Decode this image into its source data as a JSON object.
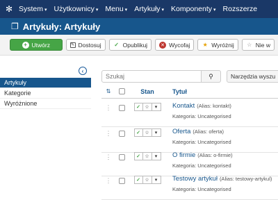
{
  "topbar": {
    "menu": [
      {
        "label": "System",
        "caret": "▾"
      },
      {
        "label": "Użytkownicy",
        "caret": "▾"
      },
      {
        "label": "Menu",
        "caret": "▾"
      },
      {
        "label": "Artykuły",
        "caret": "▾"
      },
      {
        "label": "Komponenty",
        "caret": "▾"
      },
      {
        "label": "Rozszerze",
        "caret": ""
      }
    ]
  },
  "header": {
    "title": "Artykuły: Artykuły"
  },
  "toolbar": {
    "new_label": "Utwórz",
    "edit_label": "Dostosuj",
    "publish_label": "Opublikuj",
    "unpublish_label": "Wycofaj",
    "feature_label": "Wyróżnij",
    "unfeature_label": "Nie w"
  },
  "sidebar": {
    "items": [
      {
        "label": "Artykuły",
        "active": true
      },
      {
        "label": "Kategorie",
        "active": false
      },
      {
        "label": "Wyróżnione",
        "active": false
      }
    ]
  },
  "search": {
    "placeholder": "Szukaj",
    "tools_label": "Narzędzia wyszu"
  },
  "table": {
    "headers": {
      "status": "Stan",
      "title": "Tytuł"
    },
    "rows": [
      {
        "title": "Kontakt",
        "alias": "(Alias: kontakt)",
        "category": "Kategoria: Uncategorised"
      },
      {
        "title": "Oferta",
        "alias": "(Alias: oferta)",
        "category": "Kategoria: Uncategorised"
      },
      {
        "title": "O firmie",
        "alias": "(Alias: o-firmie)",
        "category": "Kategoria: Uncategorised"
      },
      {
        "title": "Testowy artykuł",
        "alias": "(Alias: testowy-artykul)",
        "category": "Kategoria: Uncategorised"
      }
    ]
  },
  "colors": {
    "topbar": "#1a3867",
    "titlebar": "#17568c",
    "primary_button": "#46a546"
  }
}
